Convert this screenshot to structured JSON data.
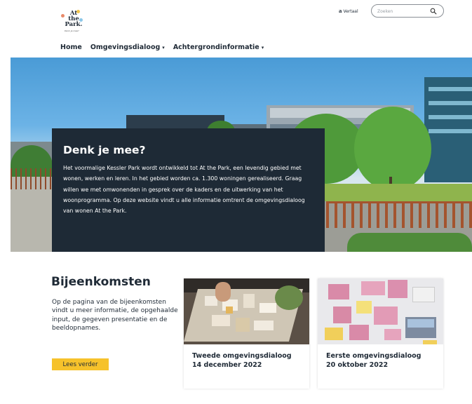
{
  "header": {
    "logo_lines": [
      "At",
      "the",
      "Park."
    ],
    "logo_tagline": "Denk je mee?",
    "lang_glyph": "a",
    "lang_label": "Vertaal",
    "search_placeholder": "Zoeken"
  },
  "nav": {
    "items": [
      {
        "label": "Home"
      },
      {
        "label": "Omgevingsdialoog",
        "caret": "▾"
      },
      {
        "label": "Achtergrondinformatie",
        "caret": "▾"
      }
    ]
  },
  "hero": {
    "title": "Denk je mee?",
    "text": "Het voormalige Kessler Park wordt ontwikkeld tot At the Park, een levendig gebied met wonen, werken en leren. In het gebied worden ca. 1.300 woningen gerealiseerd. Graag willen we met omwonenden in gesprek over de kaders en de uitwerking van het woonprogramma. Op deze website vindt u alle informatie omtrent de omgevingsdialoog van wonen At the Park."
  },
  "meetings": {
    "title": "Bijeenkomsten",
    "text": "Op de pagina van de bijeenkomsten vindt u meer informatie, de opgehaalde input, de gegeven presentatie en de beeldopnames.",
    "button": "Lees verder",
    "cards": [
      {
        "title": "Tweede omgevingsdialoog",
        "date": "14 december 2022"
      },
      {
        "title": "Eerste omgevingsdialoog",
        "date": "20 oktober 2022"
      }
    ]
  },
  "colors": {
    "navy": "#1e2a36",
    "accent_yellow": "#f6c22b"
  }
}
